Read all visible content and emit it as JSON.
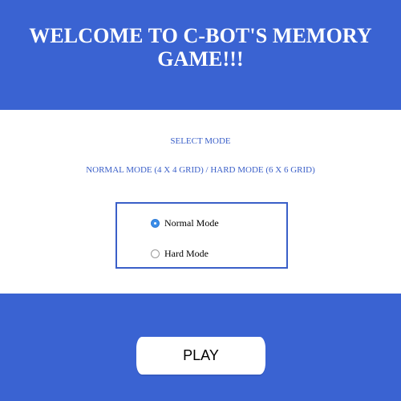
{
  "header": {
    "title_line1": "WELCOME TO C-BOT'S MEMORY",
    "title_line2": "GAME!!!"
  },
  "mode_panel": {
    "heading": "SELECT MODE",
    "description": "NORMAL MODE (4 X 4 GRID) / HARD MODE (6 X 6 GRID)",
    "options": [
      {
        "label": "Normal Mode",
        "selected": true
      },
      {
        "label": "Hard Mode",
        "selected": false
      }
    ]
  },
  "play_button": {
    "label": "PLAY"
  },
  "colors": {
    "background": "#3a63d2",
    "panel": "#ffffff",
    "accent_text": "#3a5fc8",
    "radio_selected": "#3b8de8"
  }
}
